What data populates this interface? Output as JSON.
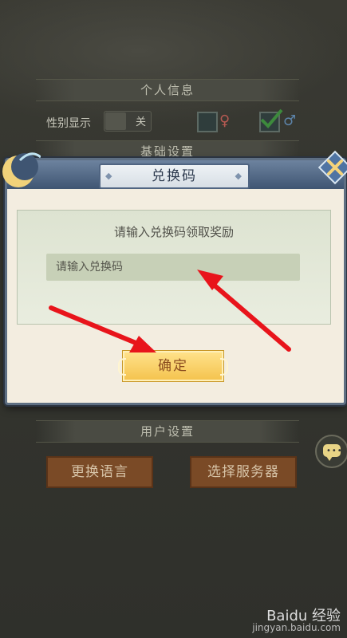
{
  "background": {
    "section_personal": "个人信息",
    "gender_label": "性别显示",
    "toggle_state": "关",
    "section_basic": "基础设置",
    "section_user": "用户设置",
    "change_language": "更换语言",
    "select_server": "选择服务器"
  },
  "dialog": {
    "title": "兑换码",
    "prompt": "请输入兑换码领取奖励",
    "input_placeholder": "请输入兑换码",
    "input_value": "",
    "confirm_label": "确定"
  },
  "watermark": {
    "brand": "Baidu 经验",
    "url": "jingyan.baidu.com"
  },
  "colors": {
    "annotation_arrow": "#e8141b",
    "confirm_button": "#f4c24c",
    "dialog_frame": "#5e6f83"
  }
}
